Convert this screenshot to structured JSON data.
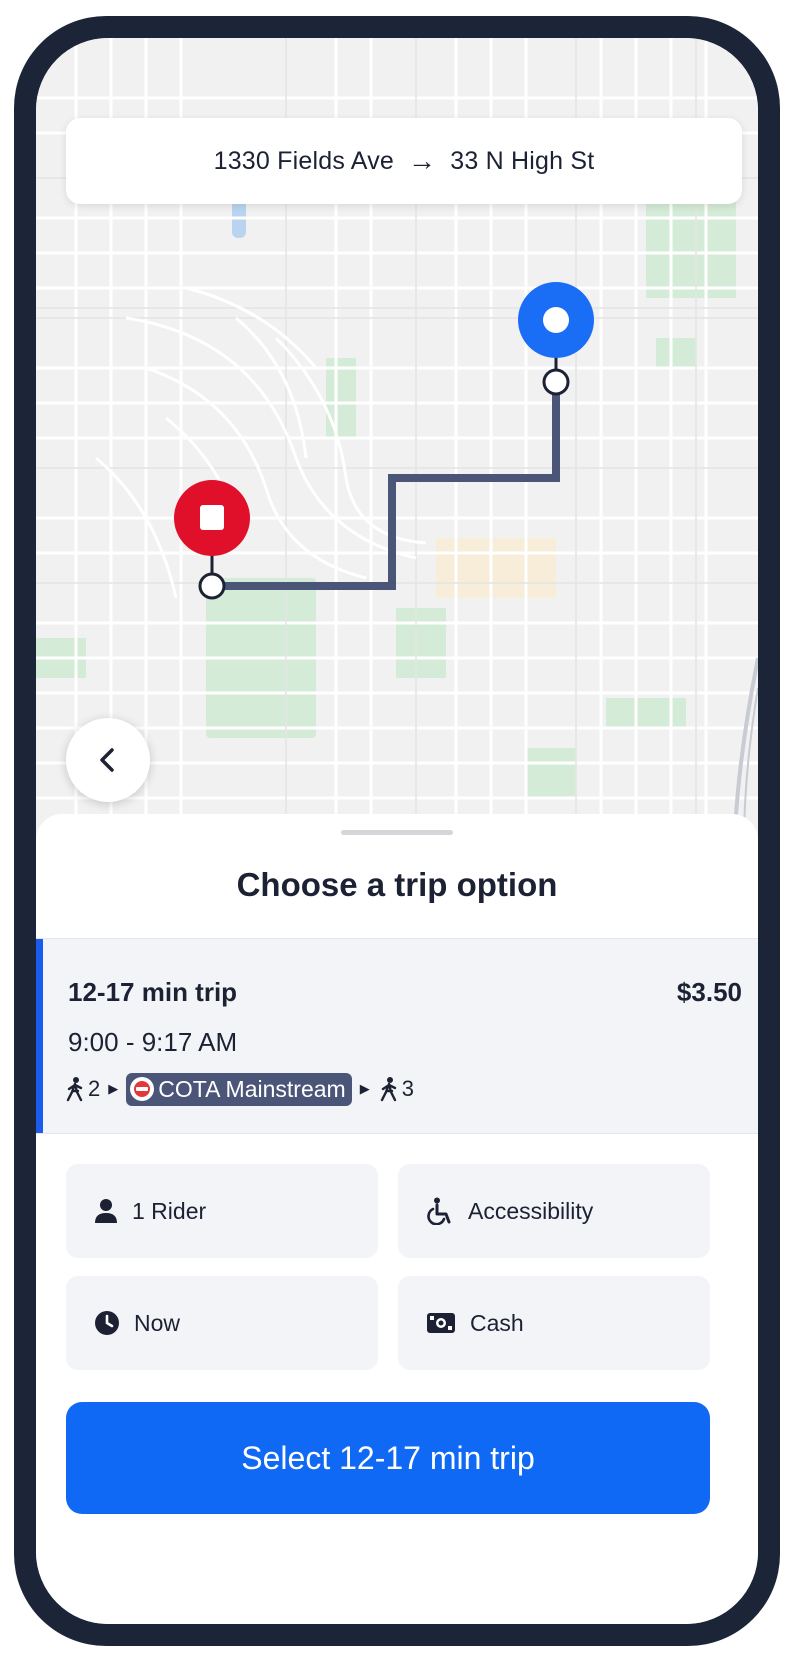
{
  "trip_header": {
    "origin": "1330 Fields Ave",
    "arrow": "→",
    "destination": "33 N High St"
  },
  "sheet": {
    "title": "Choose a trip option"
  },
  "trip_option": {
    "duration": "12-17 min trip",
    "price": "$3.50",
    "time_range": "9:00 - 9:17 AM",
    "walk_before": "2",
    "route_name": "COTA Mainstream",
    "walk_after": "3",
    "selected": true
  },
  "options": {
    "riders": "1 Rider",
    "accessibility": "Accessibility",
    "time": "Now",
    "payment": "Cash"
  },
  "select_button": "Select 12-17 min trip",
  "icons": {
    "back": "chevron-left-icon",
    "origin_marker": "stop-square-marker",
    "destination_marker": "blue-ring-marker",
    "walk": "walking-person-icon",
    "rider": "person-icon",
    "accessibility": "wheelchair-icon",
    "time": "clock-icon",
    "payment": "cash-icon"
  },
  "colors": {
    "route_line": "#4a5577",
    "origin_marker": "#e0102b",
    "destination_marker": "#1a6ef5",
    "accent": "#1a5cf0",
    "primary_button": "#1069f5",
    "park": "#cfe9d3"
  }
}
